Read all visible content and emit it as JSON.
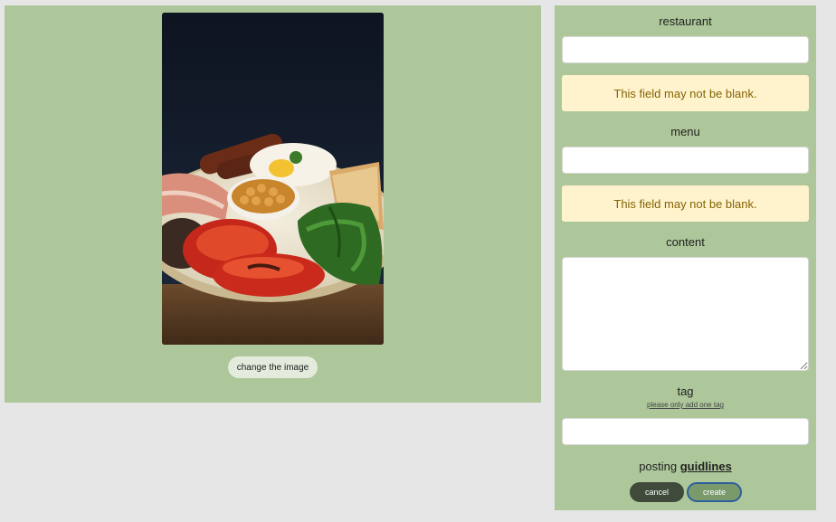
{
  "image_panel": {
    "photo_alt": "",
    "change_image_label": "change the image"
  },
  "form": {
    "restaurant": {
      "label": "restaurant",
      "value": "",
      "error": "This field may not be blank."
    },
    "menu": {
      "label": "menu",
      "value": "",
      "error": "This field may not be blank."
    },
    "content": {
      "label": "content",
      "value": ""
    },
    "tag": {
      "label": "tag",
      "hint": "please only add one tag",
      "value": ""
    },
    "guidelines": {
      "prefix": "posting",
      "link": "guidlines"
    },
    "cancel_label": "cancel",
    "create_label": "create"
  },
  "colors": {
    "panel_bg": "#adc79a",
    "page_bg": "#e6e6e6",
    "alert_bg": "#fff3cd",
    "alert_text": "#856404",
    "cancel_bg": "#3f4a3a",
    "create_bg": "#7a9a6c",
    "create_focus_ring": "#2d5f9e"
  }
}
